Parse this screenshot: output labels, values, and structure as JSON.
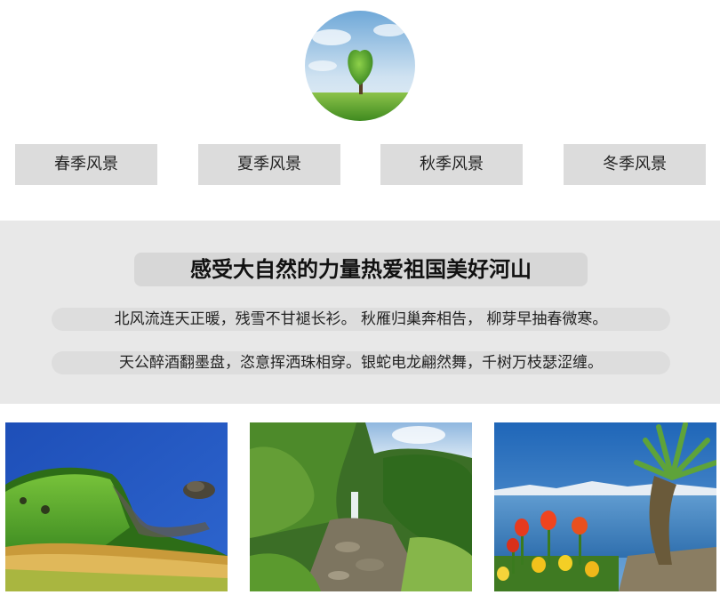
{
  "logo": {
    "icon": "heart-tree-icon"
  },
  "nav": {
    "items": [
      {
        "label": "春季风景"
      },
      {
        "label": "夏季风景"
      },
      {
        "label": "秋季风景"
      },
      {
        "label": "冬季风景"
      }
    ]
  },
  "banner": {
    "title": "感受大自然的力量热爱祖国美好河山",
    "lines": [
      "北风流连天正暖，残雪不甘褪长衫。 秋雁归巢奔相告， 柳芽早抽春微寒。",
      "天公醉酒翻墨盘，恣意挥洒珠相穿。银蛇电龙翩然舞，千树万枝瑟涩缠。"
    ]
  },
  "gallery": {
    "photos": [
      {
        "icon": "coastal-meadow-photo"
      },
      {
        "icon": "waterfall-valley-photo"
      },
      {
        "icon": "lakeside-tulips-photo"
      }
    ]
  }
}
